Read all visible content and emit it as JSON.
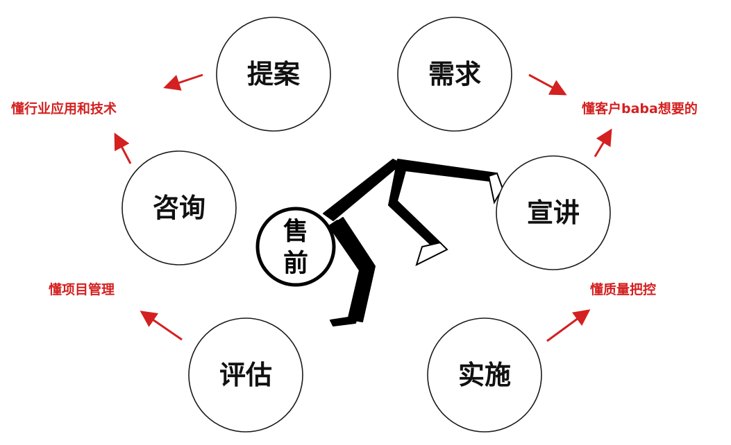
{
  "center": {
    "line1": "售",
    "line2": "前"
  },
  "stages": {
    "proposal": "提案",
    "requirement": "需求",
    "consulting": "咨询",
    "presentation": "宣讲",
    "assessment": "评估",
    "implementation": "实施"
  },
  "skills": {
    "industry": "懂行业应用和技术",
    "customer": "懂客户baba想要的",
    "project": "懂项目管理",
    "quality": "懂质量把控"
  },
  "colors": {
    "accent": "#d42020",
    "ink": "#111111",
    "background": "#ffffff"
  }
}
